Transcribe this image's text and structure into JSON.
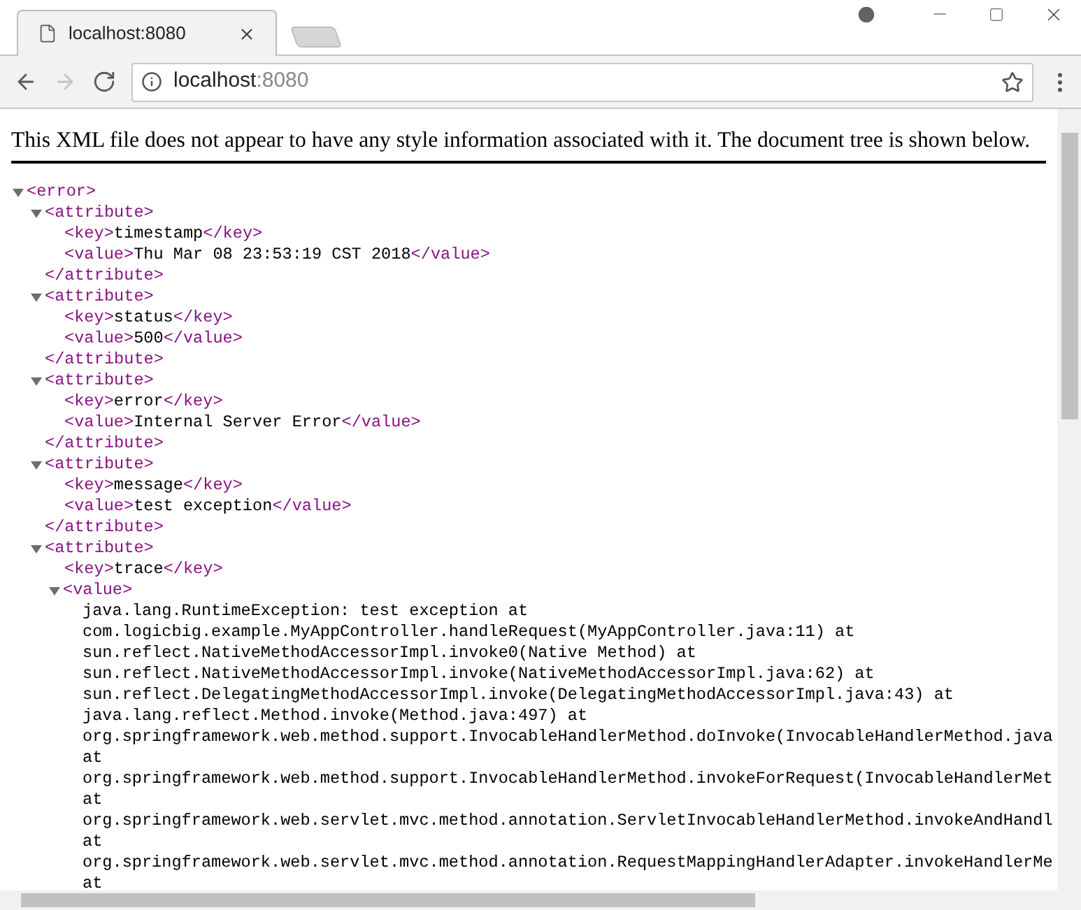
{
  "browser": {
    "tab": {
      "title": "localhost:8080"
    },
    "nav_buttons": [
      {
        "kind": "back",
        "disabled": false
      },
      {
        "kind": "forward",
        "disabled": true
      },
      {
        "kind": "reload",
        "disabled": false
      }
    ],
    "address": {
      "host": "localhost",
      "port": ":8080"
    }
  },
  "notice": "This XML file does not appear to have any style information associated with it. The document tree is shown below.",
  "tree": {
    "open": "<error>",
    "expanded": true,
    "children": [
      {
        "open": "<attribute>",
        "expanded": true,
        "close": "</attribute>",
        "children": [
          {
            "open": "<key>",
            "text": "timestamp",
            "close": "</key>"
          },
          {
            "open": "<value>",
            "text": "Thu Mar 08 23:53:19 CST 2018",
            "close": "</value>"
          }
        ]
      },
      {
        "open": "<attribute>",
        "expanded": true,
        "close": "</attribute>",
        "children": [
          {
            "open": "<key>",
            "text": "status",
            "close": "</key>"
          },
          {
            "open": "<value>",
            "text": "500",
            "close": "</value>"
          }
        ]
      },
      {
        "open": "<attribute>",
        "expanded": true,
        "close": "</attribute>",
        "children": [
          {
            "open": "<key>",
            "text": "error",
            "close": "</key>"
          },
          {
            "open": "<value>",
            "text": "Internal Server Error",
            "close": "</value>"
          }
        ]
      },
      {
        "open": "<attribute>",
        "expanded": true,
        "close": "</attribute>",
        "children": [
          {
            "open": "<key>",
            "text": "message",
            "close": "</key>"
          },
          {
            "open": "<value>",
            "text": "test exception",
            "close": "</value>"
          }
        ]
      },
      {
        "open": "<attribute>",
        "expanded": true,
        "children": [
          {
            "open": "<key>",
            "text": "trace",
            "close": "</key>"
          },
          {
            "open": "<value>",
            "expanded": true,
            "lines": [
              "java.lang.RuntimeException: test exception at",
              "com.logicbig.example.MyAppController.handleRequest(MyAppController.java:11) at",
              "sun.reflect.NativeMethodAccessorImpl.invoke0(Native Method) at",
              "sun.reflect.NativeMethodAccessorImpl.invoke(NativeMethodAccessorImpl.java:62) at",
              "sun.reflect.DelegatingMethodAccessorImpl.invoke(DelegatingMethodAccessorImpl.java:43) at",
              "java.lang.reflect.Method.invoke(Method.java:497) at",
              "org.springframework.web.method.support.InvocableHandlerMethod.doInvoke(InvocableHandlerMethod.java",
              "at",
              "org.springframework.web.method.support.InvocableHandlerMethod.invokeForRequest(InvocableHandlerMet",
              "at",
              "org.springframework.web.servlet.mvc.method.annotation.ServletInvocableHandlerMethod.invokeAndHandl",
              "at",
              "org.springframework.web.servlet.mvc.method.annotation.RequestMappingHandlerAdapter.invokeHandlerMe",
              "at"
            ]
          }
        ]
      }
    ]
  }
}
